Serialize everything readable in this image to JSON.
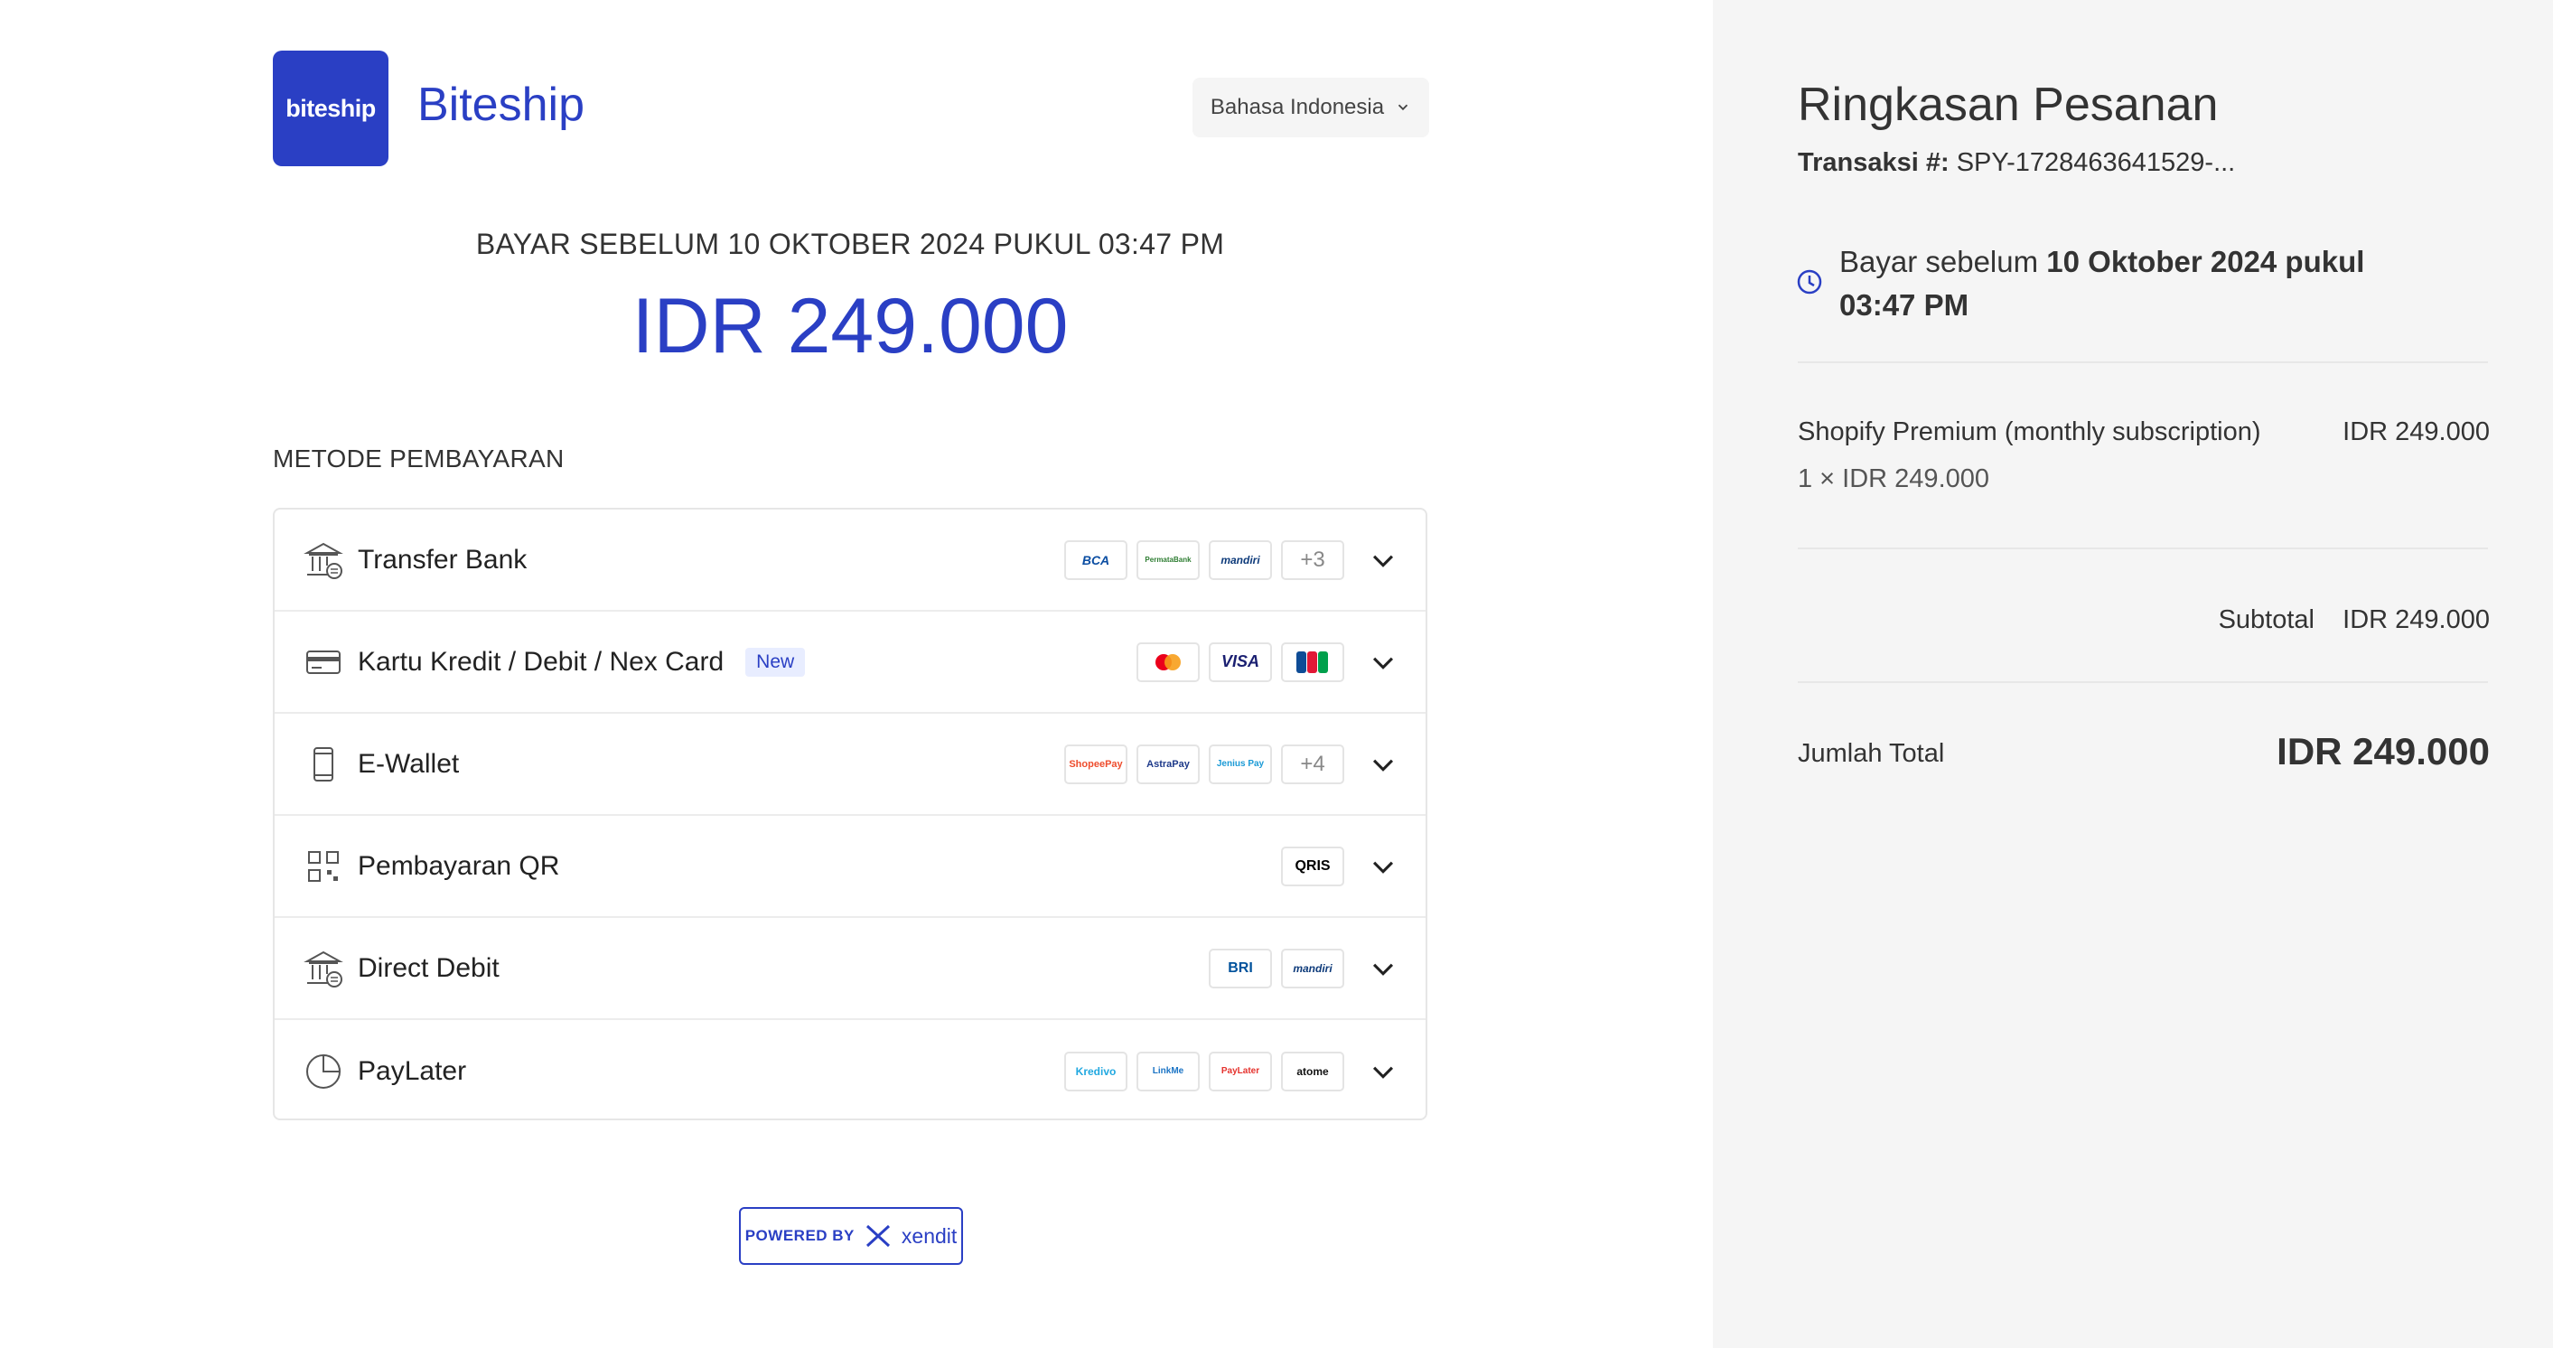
{
  "header": {
    "logo_text": "biteship",
    "brand_name": "Biteship",
    "language": "Bahasa Indonesia"
  },
  "payment": {
    "deadline": "BAYAR SEBELUM 10 OKTOBER 2024 PUKUL 03:47 PM",
    "amount": "IDR 249.000",
    "methods_label": "METODE PEMBAYARAN"
  },
  "methods": [
    {
      "label": "Transfer Bank",
      "logos": [
        "BCA",
        "PermataBank",
        "mandiri"
      ],
      "more": "+3"
    },
    {
      "label": "Kartu Kredit / Debit / Nex Card",
      "badge": "New",
      "logos": [
        "Mastercard",
        "VISA",
        "JCB"
      ]
    },
    {
      "label": "E-Wallet",
      "logos": [
        "ShopeePay",
        "AstraPay",
        "Jenius Pay"
      ],
      "more": "+4"
    },
    {
      "label": "Pembayaran QR",
      "logos": [
        "QRIS"
      ]
    },
    {
      "label": "Direct Debit",
      "logos": [
        "BRI",
        "mandiri"
      ]
    },
    {
      "label": "PayLater",
      "logos": [
        "Kredivo",
        "LinkMe",
        "PayLater",
        "atome"
      ]
    }
  ],
  "footer": {
    "powered_by": "POWERED BY",
    "provider": "xendit"
  },
  "summary": {
    "title": "Ringkasan Pesanan",
    "transaction_label": "Transaksi #:",
    "transaction_id": "SPY-1728463641529-...",
    "due_prefix": "Bayar sebelum",
    "due_date": "10 Oktober 2024 pukul",
    "due_time": "03:47 PM",
    "item_name": "Shopify Premium (monthly subscription)",
    "item_price": "IDR 249.000",
    "item_qty": "1 × IDR 249.000",
    "subtotal_label": "Subtotal",
    "subtotal_value": "IDR 249.000",
    "total_label": "Jumlah Total",
    "total_value": "IDR 249.000"
  },
  "colors": {
    "accent": "#2a3fc4",
    "panel": "#f5f5f5"
  }
}
